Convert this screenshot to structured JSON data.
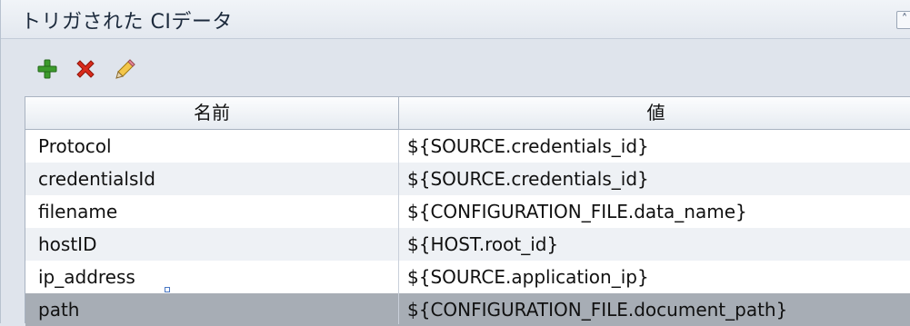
{
  "panel": {
    "title": "トリガされた CIデータ",
    "collapse_icon": "double-chevron-up-icon"
  },
  "toolbar": {
    "add_icon": "add-icon",
    "delete_icon": "delete-icon",
    "edit_icon": "edit-icon"
  },
  "table": {
    "columns": [
      "名前",
      "値"
    ],
    "rows": [
      {
        "name": "Protocol",
        "value": "${SOURCE.credentials_id}"
      },
      {
        "name": "credentialsId",
        "value": "${SOURCE.credentials_id}"
      },
      {
        "name": "filename",
        "value": "${CONFIGURATION_FILE.data_name}"
      },
      {
        "name": "hostID",
        "value": "${HOST.root_id}"
      },
      {
        "name": "ip_address",
        "value": "${SOURCE.application_ip}"
      },
      {
        "name": "path",
        "value": "${CONFIGURATION_FILE.document_path}",
        "selected": true
      }
    ]
  },
  "colors": {
    "selected_row": "#a7adb5",
    "alt_row": "#eef1f5",
    "add_green": "#3c9b2c",
    "delete_red": "#d92b1c"
  }
}
